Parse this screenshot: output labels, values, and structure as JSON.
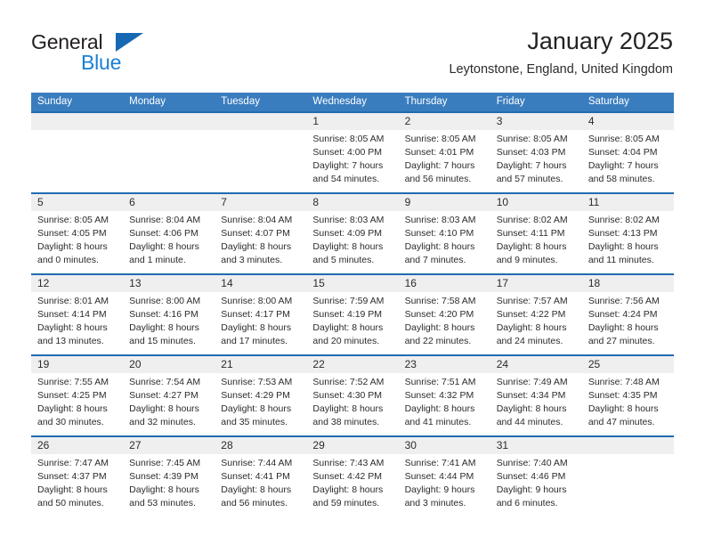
{
  "brand": {
    "name_part1": "General",
    "name_part2": "Blue",
    "triangle_color": "#1668b3",
    "blue_color": "#1a7fd4"
  },
  "header": {
    "title": "January 2025",
    "location": "Leytonstone, England, United Kingdom"
  },
  "theme": {
    "header_row_bg": "#3a7dbf",
    "week_divider": "#1f6cb0",
    "daynum_band_bg": "#efefef",
    "text": "#2b2b2b"
  },
  "weekdays": [
    "Sunday",
    "Monday",
    "Tuesday",
    "Wednesday",
    "Thursday",
    "Friday",
    "Saturday"
  ],
  "weeks": [
    [
      {
        "day": "",
        "info": ""
      },
      {
        "day": "",
        "info": ""
      },
      {
        "day": "",
        "info": ""
      },
      {
        "day": "1",
        "info": "Sunrise: 8:05 AM\nSunset: 4:00 PM\nDaylight: 7 hours\nand 54 minutes."
      },
      {
        "day": "2",
        "info": "Sunrise: 8:05 AM\nSunset: 4:01 PM\nDaylight: 7 hours\nand 56 minutes."
      },
      {
        "day": "3",
        "info": "Sunrise: 8:05 AM\nSunset: 4:03 PM\nDaylight: 7 hours\nand 57 minutes."
      },
      {
        "day": "4",
        "info": "Sunrise: 8:05 AM\nSunset: 4:04 PM\nDaylight: 7 hours\nand 58 minutes."
      }
    ],
    [
      {
        "day": "5",
        "info": "Sunrise: 8:05 AM\nSunset: 4:05 PM\nDaylight: 8 hours\nand 0 minutes."
      },
      {
        "day": "6",
        "info": "Sunrise: 8:04 AM\nSunset: 4:06 PM\nDaylight: 8 hours\nand 1 minute."
      },
      {
        "day": "7",
        "info": "Sunrise: 8:04 AM\nSunset: 4:07 PM\nDaylight: 8 hours\nand 3 minutes."
      },
      {
        "day": "8",
        "info": "Sunrise: 8:03 AM\nSunset: 4:09 PM\nDaylight: 8 hours\nand 5 minutes."
      },
      {
        "day": "9",
        "info": "Sunrise: 8:03 AM\nSunset: 4:10 PM\nDaylight: 8 hours\nand 7 minutes."
      },
      {
        "day": "10",
        "info": "Sunrise: 8:02 AM\nSunset: 4:11 PM\nDaylight: 8 hours\nand 9 minutes."
      },
      {
        "day": "11",
        "info": "Sunrise: 8:02 AM\nSunset: 4:13 PM\nDaylight: 8 hours\nand 11 minutes."
      }
    ],
    [
      {
        "day": "12",
        "info": "Sunrise: 8:01 AM\nSunset: 4:14 PM\nDaylight: 8 hours\nand 13 minutes."
      },
      {
        "day": "13",
        "info": "Sunrise: 8:00 AM\nSunset: 4:16 PM\nDaylight: 8 hours\nand 15 minutes."
      },
      {
        "day": "14",
        "info": "Sunrise: 8:00 AM\nSunset: 4:17 PM\nDaylight: 8 hours\nand 17 minutes."
      },
      {
        "day": "15",
        "info": "Sunrise: 7:59 AM\nSunset: 4:19 PM\nDaylight: 8 hours\nand 20 minutes."
      },
      {
        "day": "16",
        "info": "Sunrise: 7:58 AM\nSunset: 4:20 PM\nDaylight: 8 hours\nand 22 minutes."
      },
      {
        "day": "17",
        "info": "Sunrise: 7:57 AM\nSunset: 4:22 PM\nDaylight: 8 hours\nand 24 minutes."
      },
      {
        "day": "18",
        "info": "Sunrise: 7:56 AM\nSunset: 4:24 PM\nDaylight: 8 hours\nand 27 minutes."
      }
    ],
    [
      {
        "day": "19",
        "info": "Sunrise: 7:55 AM\nSunset: 4:25 PM\nDaylight: 8 hours\nand 30 minutes."
      },
      {
        "day": "20",
        "info": "Sunrise: 7:54 AM\nSunset: 4:27 PM\nDaylight: 8 hours\nand 32 minutes."
      },
      {
        "day": "21",
        "info": "Sunrise: 7:53 AM\nSunset: 4:29 PM\nDaylight: 8 hours\nand 35 minutes."
      },
      {
        "day": "22",
        "info": "Sunrise: 7:52 AM\nSunset: 4:30 PM\nDaylight: 8 hours\nand 38 minutes."
      },
      {
        "day": "23",
        "info": "Sunrise: 7:51 AM\nSunset: 4:32 PM\nDaylight: 8 hours\nand 41 minutes."
      },
      {
        "day": "24",
        "info": "Sunrise: 7:49 AM\nSunset: 4:34 PM\nDaylight: 8 hours\nand 44 minutes."
      },
      {
        "day": "25",
        "info": "Sunrise: 7:48 AM\nSunset: 4:35 PM\nDaylight: 8 hours\nand 47 minutes."
      }
    ],
    [
      {
        "day": "26",
        "info": "Sunrise: 7:47 AM\nSunset: 4:37 PM\nDaylight: 8 hours\nand 50 minutes."
      },
      {
        "day": "27",
        "info": "Sunrise: 7:45 AM\nSunset: 4:39 PM\nDaylight: 8 hours\nand 53 minutes."
      },
      {
        "day": "28",
        "info": "Sunrise: 7:44 AM\nSunset: 4:41 PM\nDaylight: 8 hours\nand 56 minutes."
      },
      {
        "day": "29",
        "info": "Sunrise: 7:43 AM\nSunset: 4:42 PM\nDaylight: 8 hours\nand 59 minutes."
      },
      {
        "day": "30",
        "info": "Sunrise: 7:41 AM\nSunset: 4:44 PM\nDaylight: 9 hours\nand 3 minutes."
      },
      {
        "day": "31",
        "info": "Sunrise: 7:40 AM\nSunset: 4:46 PM\nDaylight: 9 hours\nand 6 minutes."
      },
      {
        "day": "",
        "info": ""
      }
    ]
  ]
}
